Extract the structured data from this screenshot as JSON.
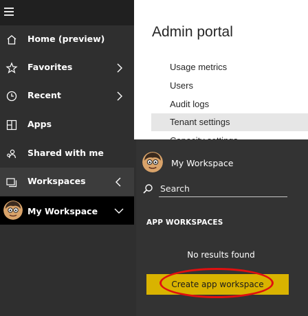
{
  "nav": {
    "items": [
      {
        "label": "Home (preview)",
        "icon": "home-icon"
      },
      {
        "label": "Favorites",
        "icon": "star-icon"
      },
      {
        "label": "Recent",
        "icon": "clock-icon"
      },
      {
        "label": "Apps",
        "icon": "apps-icon"
      },
      {
        "label": "Shared with me",
        "icon": "shared-icon"
      },
      {
        "label": "Workspaces",
        "icon": "workspaces-icon"
      },
      {
        "label": "My Workspace",
        "icon": "avatar"
      }
    ]
  },
  "admin": {
    "title": "Admin portal",
    "links": [
      {
        "label": "Usage metrics",
        "active": false
      },
      {
        "label": "Users",
        "active": false
      },
      {
        "label": "Audit logs",
        "active": false
      },
      {
        "label": "Tenant settings",
        "active": true
      },
      {
        "label": "Capacity settings",
        "active": false
      }
    ]
  },
  "flyout": {
    "my_workspace": "My Workspace",
    "search_placeholder": "Search",
    "section_title": "APP WORKSPACES",
    "no_results": "No results found",
    "create_button": "Create app workspace"
  },
  "colors": {
    "nav_bg": "#2f2f2f",
    "flyout_bg": "#333333",
    "accent": "#f2c811",
    "button": "#d9b300",
    "highlight_oval": "#e01010"
  }
}
